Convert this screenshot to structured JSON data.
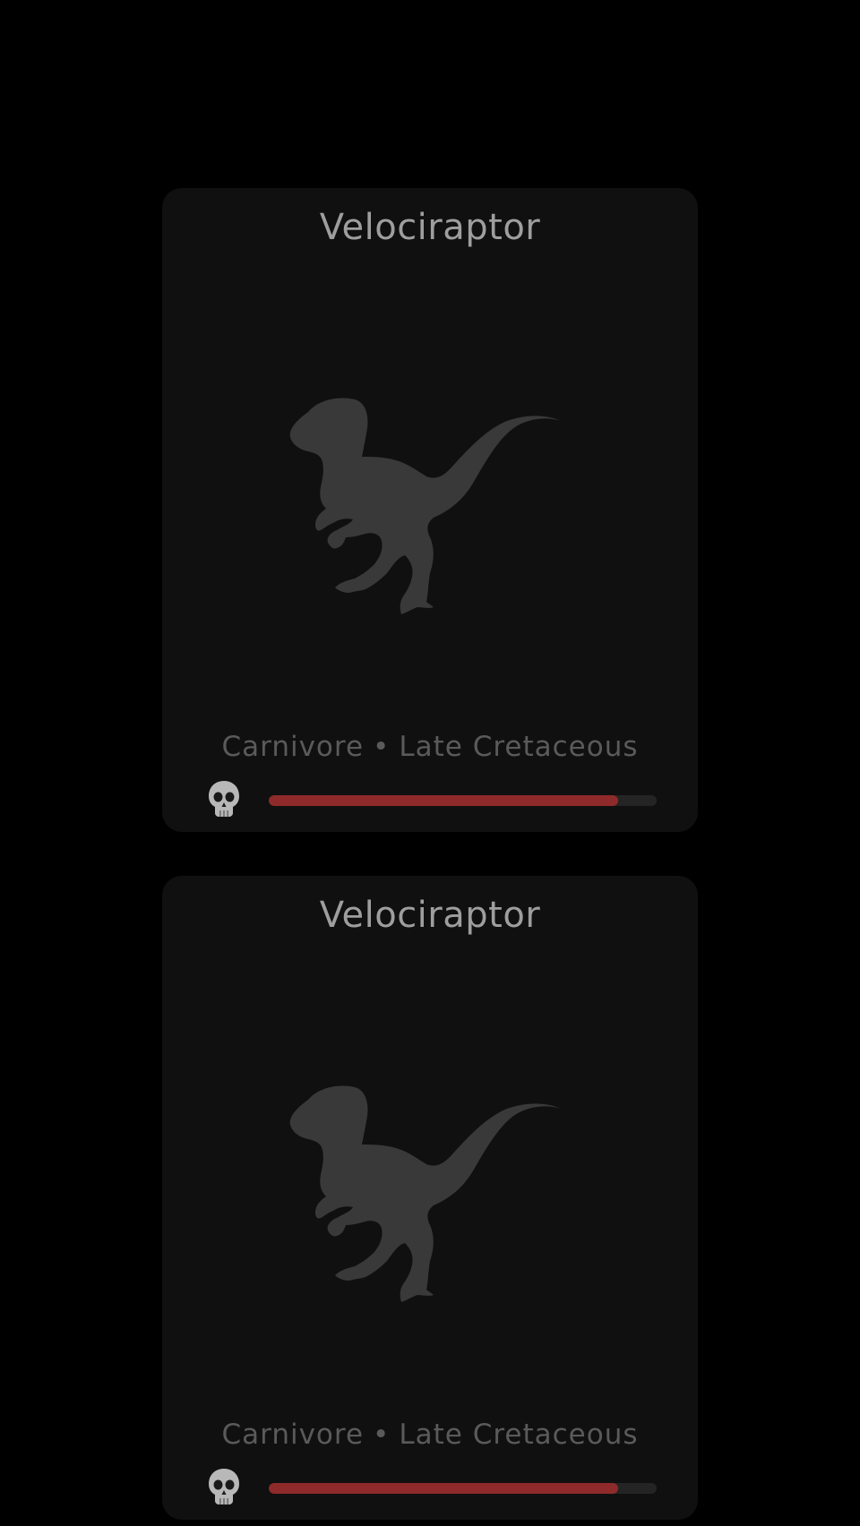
{
  "colors": {
    "background": "#000000",
    "card": "#101010",
    "title_text": "#9e9e9e",
    "meta_text": "#5a5a5a",
    "silhouette": "#393939",
    "danger_fill": "#8f2a2a",
    "danger_track": "#242424"
  },
  "cards": [
    {
      "name": "Velociraptor",
      "diet": "Carnivore",
      "separator": "•",
      "period": "Late Cretaceous",
      "image_icon": "velociraptor-silhouette-icon",
      "danger_icon": "skull-icon",
      "danger_level": 0.9
    },
    {
      "name": "Velociraptor",
      "diet": "Carnivore",
      "separator": "•",
      "period": "Late Cretaceous",
      "image_icon": "velociraptor-silhouette-icon",
      "danger_icon": "skull-icon",
      "danger_level": 0.9
    }
  ]
}
